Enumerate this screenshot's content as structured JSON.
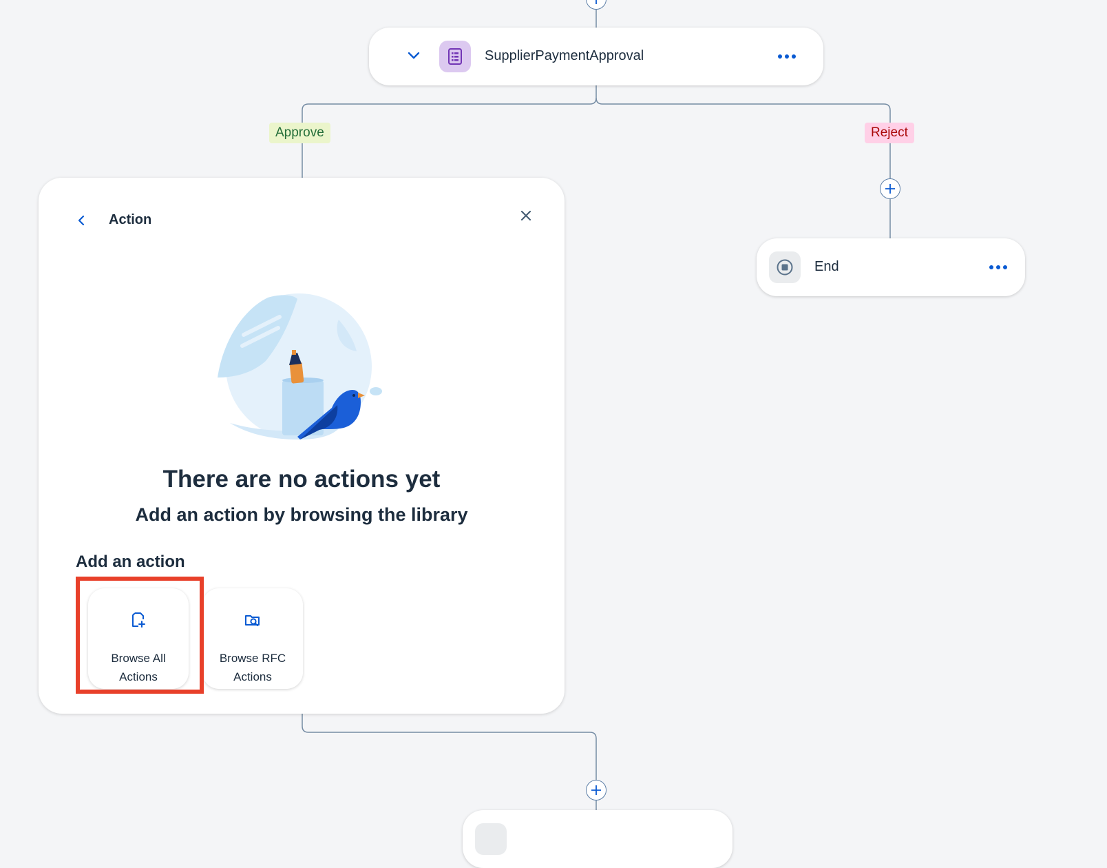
{
  "flow": {
    "top_step": {
      "title": "SupplierPaymentApproval"
    },
    "branches": {
      "approve_label": "Approve",
      "reject_label": "Reject"
    },
    "end_step": {
      "title": "End"
    }
  },
  "panel": {
    "title": "Action",
    "empty_title": "There are no actions yet",
    "empty_subtitle": "Add an action by browsing the library",
    "section_label": "Add an action",
    "tiles": [
      {
        "label_line1": "Browse All",
        "label_line2": "Actions"
      },
      {
        "label_line1": "Browse RFC",
        "label_line2": "Actions"
      }
    ]
  },
  "colors": {
    "accent": "#0a5ad2",
    "approve_bg": "#ebf5cb",
    "approve_text": "#256f3a",
    "reject_bg": "#ffd0e7",
    "reject_text": "#aa0808",
    "highlight": "#e8402a",
    "connector": "#758ca4"
  },
  "icons": {
    "top_step_icon": "form-icon",
    "end_step_icon": "stop-circle-icon",
    "tile_all_icon": "document-add-icon",
    "tile_rfc_icon": "folder-search-icon"
  }
}
